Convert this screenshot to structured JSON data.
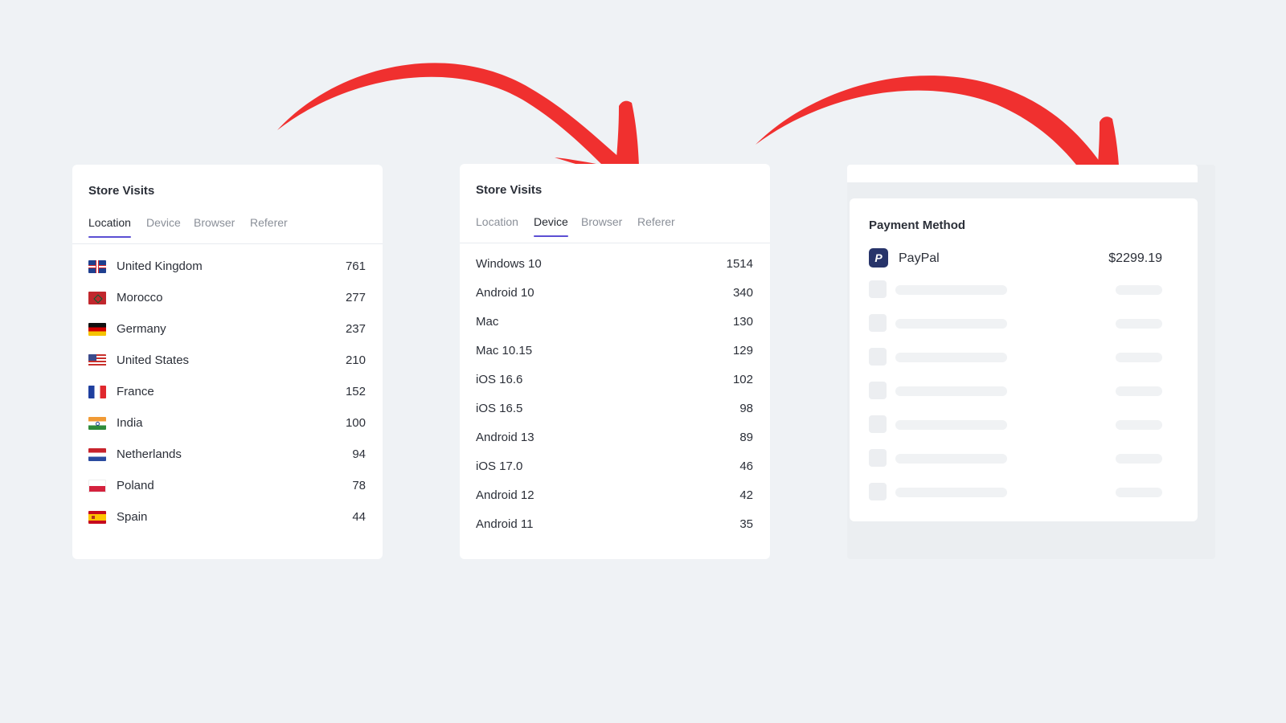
{
  "store_visits_location": {
    "title": "Store Visits",
    "tabs": [
      "Location",
      "Device",
      "Browser",
      "Referer"
    ],
    "active_tab": "Location",
    "rows": [
      {
        "label": "United Kingdom",
        "value": "761",
        "flag": "gb-flag-icon"
      },
      {
        "label": "Morocco",
        "value": "277",
        "flag": "ma-flag-icon"
      },
      {
        "label": "Germany",
        "value": "237",
        "flag": "de-flag-icon"
      },
      {
        "label": "United States",
        "value": "210",
        "flag": "us-flag-icon"
      },
      {
        "label": "France",
        "value": "152",
        "flag": "fr-flag-icon"
      },
      {
        "label": "India",
        "value": "100",
        "flag": "in-flag-icon"
      },
      {
        "label": "Netherlands",
        "value": "94",
        "flag": "nl-flag-icon"
      },
      {
        "label": "Poland",
        "value": "78",
        "flag": "pl-flag-icon"
      },
      {
        "label": "Spain",
        "value": "44",
        "flag": "es-flag-icon"
      }
    ]
  },
  "store_visits_device": {
    "title": "Store Visits",
    "tabs": [
      "Location",
      "Device",
      "Browser",
      "Referer"
    ],
    "active_tab": "Device",
    "rows": [
      {
        "label": "Windows 10",
        "value": "1514"
      },
      {
        "label": "Android 10",
        "value": "340"
      },
      {
        "label": "Mac",
        "value": "130"
      },
      {
        "label": "Mac 10.15",
        "value": "129"
      },
      {
        "label": "iOS 16.6",
        "value": "102"
      },
      {
        "label": "iOS 16.5",
        "value": "98"
      },
      {
        "label": "Android 13",
        "value": "89"
      },
      {
        "label": "iOS 17.0",
        "value": "46"
      },
      {
        "label": "Android 12",
        "value": "42"
      },
      {
        "label": "Android 11",
        "value": "35"
      }
    ]
  },
  "payment_method": {
    "title": "Payment Method",
    "item": {
      "name": "PayPal",
      "amount": "$2299.19",
      "icon": "paypal-icon"
    },
    "skeleton_rows": 7
  },
  "colors": {
    "background": "#eff2f5",
    "card": "#ffffff",
    "active_tab_underline": "#5b4fd3",
    "arrow": "#f0302f",
    "text": "#2b2f38",
    "muted_text": "#8a8f98"
  }
}
